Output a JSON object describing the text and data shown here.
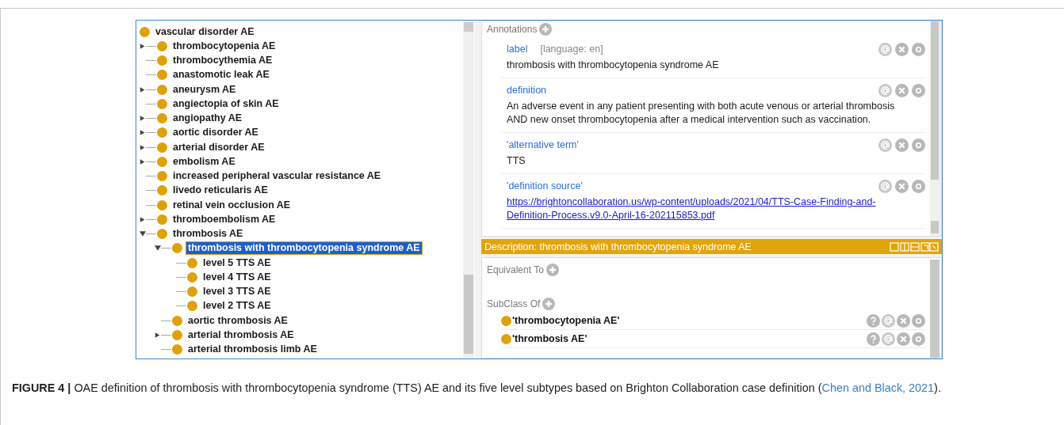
{
  "tree": [
    {
      "label": "vascular disorder AE",
      "selected": false,
      "children": [
        {
          "label": "thrombocytopenia AE",
          "kind": "collapsed",
          "selected": false
        },
        {
          "label": "thrombocythemia AE",
          "kind": "leaf",
          "selected": false
        },
        {
          "label": "anastomotic leak AE",
          "kind": "leaf",
          "selected": false
        },
        {
          "label": "aneurysm AE",
          "kind": "collapsed",
          "selected": false
        },
        {
          "label": "angiectopia of skin AE",
          "kind": "leaf",
          "selected": false
        },
        {
          "label": "angiopathy AE",
          "kind": "collapsed",
          "selected": false
        },
        {
          "label": "aortic disorder AE",
          "kind": "collapsed",
          "selected": false
        },
        {
          "label": "arterial disorder AE",
          "kind": "collapsed",
          "selected": false
        },
        {
          "label": "embolism AE",
          "kind": "collapsed",
          "selected": false
        },
        {
          "label": "increased peripheral vascular resistance AE",
          "kind": "leaf",
          "selected": false
        },
        {
          "label": "livedo reticularis AE",
          "kind": "leaf",
          "selected": false
        },
        {
          "label": "retinal vein occlusion AE",
          "kind": "leaf",
          "selected": false
        },
        {
          "label": "thromboembolism AE",
          "kind": "collapsed",
          "selected": false
        },
        {
          "label": "thrombosis AE",
          "kind": "expanded",
          "selected": false,
          "children": [
            {
              "label": "thrombosis with thrombocytopenia syndrome AE",
              "kind": "expanded",
              "selected": true,
              "children": [
                {
                  "label": "level 5 TTS AE",
                  "kind": "leaf",
                  "selected": false
                },
                {
                  "label": "level 4 TTS AE",
                  "kind": "leaf",
                  "selected": false
                },
                {
                  "label": "level 3 TTS AE",
                  "kind": "leaf",
                  "selected": false
                },
                {
                  "label": "level 2 TTS AE",
                  "kind": "leaf",
                  "selected": false
                }
              ]
            },
            {
              "label": "aortic thrombosis AE",
              "kind": "leaf",
              "selected": false
            },
            {
              "label": "arterial thrombosis AE",
              "kind": "collapsed",
              "selected": false
            },
            {
              "label": "arterial thrombosis limb AE",
              "kind": "leaf",
              "selected": false
            }
          ]
        }
      ]
    }
  ],
  "annotations": {
    "title": "Annotations",
    "items": [
      {
        "property": "label",
        "language": "[language: en]",
        "kind": "text",
        "value": "thrombosis with thrombocytopenia syndrome AE"
      },
      {
        "property": "definition",
        "kind": "text",
        "value": "An adverse event in any patient presenting with both acute venous or arterial thrombosis AND new onset thrombocytopenia after a medical intervention such as vaccination."
      },
      {
        "property": "'alternative term'",
        "kind": "text",
        "value": "TTS"
      },
      {
        "property": "'definition source'",
        "kind": "link",
        "value": "https://brightoncollaboration.us/wp-content/uploads/2021/04/TTS-Case-Finding-and-Definition-Process.v9.0-April-16-202115853.pdf"
      }
    ]
  },
  "description_bar": {
    "title": "Description: thrombosis with thrombocytopenia syndrome AE"
  },
  "description": {
    "equivalent_to": "Equivalent To",
    "subclass_of": "SubClass Of",
    "superclasses": [
      "'thrombocytopenia AE'",
      "'thrombosis AE'"
    ]
  },
  "caption": {
    "text": "**FIGURE 4 |** OAE definition of thrombosis with thrombocytopenia syndrome (TTS) AE and its five level subtypes based on Brighton Collaboration case definition (",
    "link": "Chen and Black, 2021",
    "after": ")."
  }
}
